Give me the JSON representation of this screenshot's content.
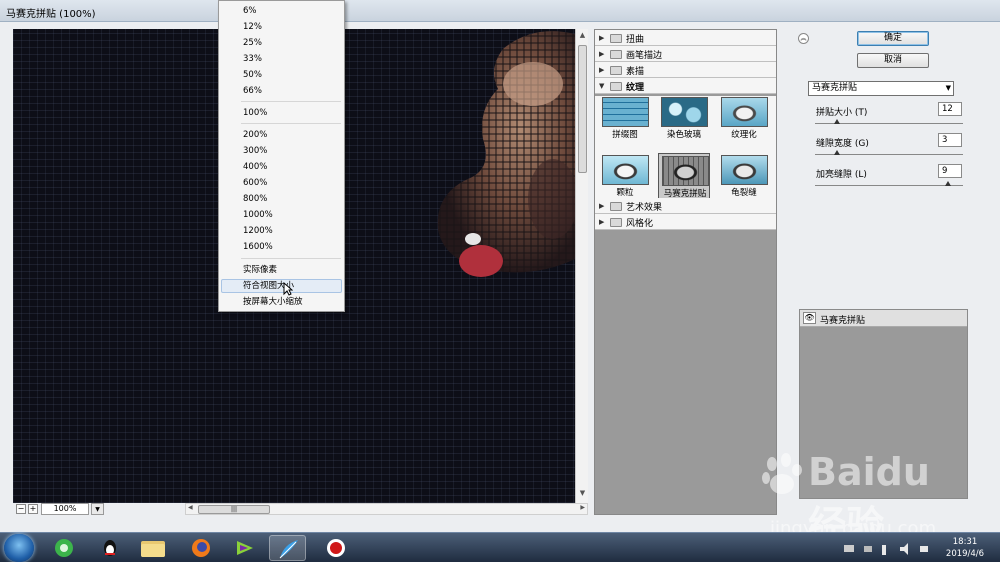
{
  "window": {
    "title": "马赛克拼贴 (100%)"
  },
  "zoom": {
    "value": "100%",
    "minus": "−",
    "plus": "+"
  },
  "zoom_menu": {
    "percent_items": [
      "6%",
      "12%",
      "25%",
      "33%",
      "50%",
      "66%"
    ],
    "hundred": "100%",
    "large_items": [
      "200%",
      "300%",
      "400%",
      "600%",
      "800%",
      "1000%",
      "1200%",
      "1600%"
    ],
    "actual_pixels": "实际像素",
    "fit_view": "符合视图大小",
    "fit_screen": "按屏幕大小缩放"
  },
  "gallery": {
    "categories": {
      "distort": "扭曲",
      "brush_strokes": "画笔描边",
      "sketch": "素描",
      "texture": "纹理",
      "artistic": "艺术效果",
      "stylize": "风格化"
    },
    "thumbs": [
      "拼缀图",
      "染色玻璃",
      "纹理化",
      "颗粒",
      "马赛克拼贴",
      "龟裂缝"
    ],
    "selected": "马赛克拼贴"
  },
  "controls": {
    "ok": "确定",
    "cancel": "取消",
    "filter_select": "马赛克拼贴",
    "params": [
      {
        "label": "拼贴大小 (T)",
        "value": "12",
        "level": 0.15
      },
      {
        "label": "缝隙宽度 (G)",
        "value": "3",
        "level": 0.15
      },
      {
        "label": "加亮缝隙 (L)",
        "value": "9",
        "level": 0.9
      }
    ]
  },
  "layers": {
    "effect_layer": "马赛克拼贴"
  },
  "watermark": {
    "brand": "Baidu 经验",
    "url": "jingyan.baidu.com"
  },
  "taskbar": {
    "time": "18:31",
    "date": "2019/4/6"
  },
  "colors": {
    "canvas_bg": "#0d0e17",
    "taskbar": "#2a3a52",
    "accent": "#3c7fb1"
  }
}
